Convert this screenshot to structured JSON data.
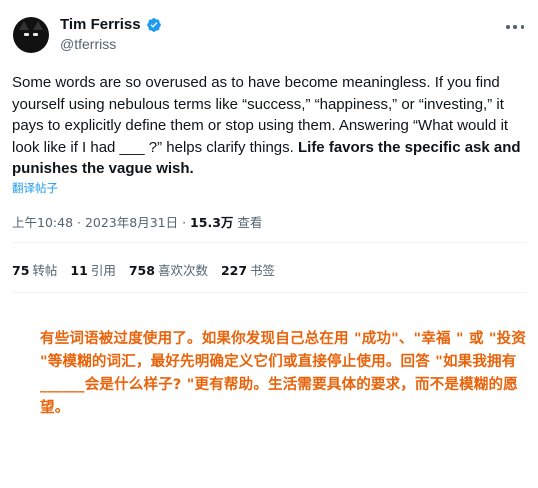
{
  "author": {
    "display_name": "Tim Ferriss",
    "handle": "@tferriss",
    "avatar_icon": "cat-avatar-icon",
    "verified_icon": "verified-badge-icon",
    "verified_color": "#1d9bf0"
  },
  "more_icon": "more-options-icon",
  "tweet": {
    "text_plain": "Some words are so overused as to have become meaningless. If you find yourself using nebulous terms like “success,” “happiness,” or “investing,” it pays to explicitly define them or stop using them. Answering “What would it look like if I had ___ ?” helps clarify things. ",
    "text_bold": "Life favors the specific ask and punishes the vague wish.",
    "translate_label": "翻译帖子"
  },
  "meta": {
    "time_date": "上午10:48 · 2023年8月31日 · ",
    "views_count": "15.3万",
    "views_label": " 查看"
  },
  "stats": {
    "retweets_count": "75",
    "retweets_label": "转帖",
    "quotes_count": "11",
    "quotes_label": "引用",
    "likes_count": "758",
    "likes_label": "喜欢次数",
    "bookmarks_count": "227",
    "bookmarks_label": "书签"
  },
  "annotation": {
    "text": "有些词语被过度使用了。如果你发现自己总在用 \"成功\"、\"幸福 \" 或 \"投资 \"等模糊的词汇，最好先明确定义它们或直接停止使用。回答 \"如果我拥有______会是什么样子? \"更有帮助。生活需要具体的要求，而不是模糊的愿望。",
    "color": "#e8630a"
  }
}
